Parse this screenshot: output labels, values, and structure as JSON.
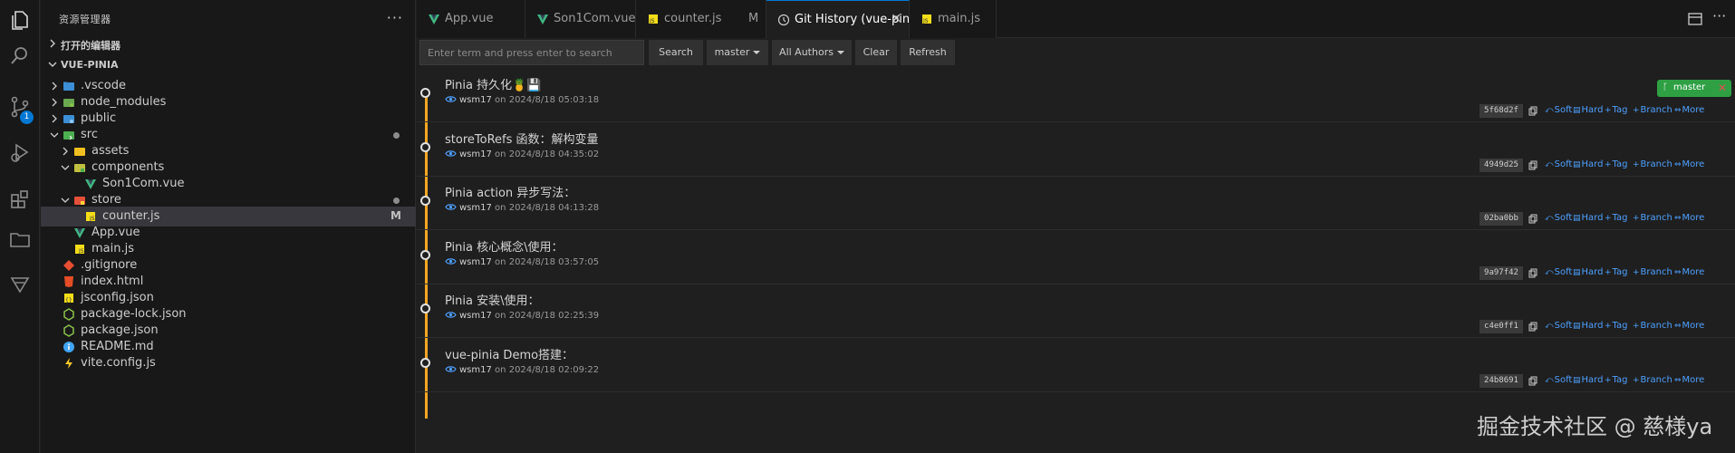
{
  "explorer": {
    "title": "资源管理器",
    "more": "···",
    "open_editors": "打开的编辑器",
    "project": "VUE-PINIA",
    "tree": [
      {
        "name": ".vscode",
        "indent": 1,
        "kind": "folder-vscode",
        "state": "collapsed"
      },
      {
        "name": "node_modules",
        "indent": 1,
        "kind": "folder-node",
        "state": "collapsed"
      },
      {
        "name": "public",
        "indent": 1,
        "kind": "folder-public",
        "state": "collapsed"
      },
      {
        "name": "src",
        "indent": 1,
        "kind": "folder-src",
        "state": "expanded",
        "dot": true
      },
      {
        "name": "assets",
        "indent": 2,
        "kind": "folder-assets",
        "state": "collapsed"
      },
      {
        "name": "components",
        "indent": 2,
        "kind": "folder-components",
        "state": "expanded"
      },
      {
        "name": "Son1Com.vue",
        "indent": 3,
        "kind": "vue"
      },
      {
        "name": "store",
        "indent": 2,
        "kind": "folder-store",
        "state": "expanded",
        "dot": true
      },
      {
        "name": "counter.js",
        "indent": 3,
        "kind": "js",
        "selected": true,
        "mod": "M"
      },
      {
        "name": "App.vue",
        "indent": 2,
        "kind": "vue"
      },
      {
        "name": "main.js",
        "indent": 2,
        "kind": "js"
      },
      {
        "name": ".gitignore",
        "indent": 1,
        "kind": "git"
      },
      {
        "name": "index.html",
        "indent": 1,
        "kind": "html"
      },
      {
        "name": "jsconfig.json",
        "indent": 1,
        "kind": "jsconfig"
      },
      {
        "name": "package-lock.json",
        "indent": 1,
        "kind": "node"
      },
      {
        "name": "package.json",
        "indent": 1,
        "kind": "node"
      },
      {
        "name": "README.md",
        "indent": 1,
        "kind": "info"
      },
      {
        "name": "vite.config.js",
        "indent": 1,
        "kind": "vite"
      }
    ]
  },
  "tabs": [
    {
      "label": "App.vue",
      "icon": "vue"
    },
    {
      "label": "Son1Com.vue",
      "icon": "vue"
    },
    {
      "label": "counter.js",
      "icon": "js",
      "mod": "M"
    },
    {
      "label": "Git History (vue-pinia)",
      "icon": "history",
      "active": true,
      "close": "✕"
    },
    {
      "label": "main.js",
      "icon": "js"
    }
  ],
  "toolbar": {
    "search_placeholder": "Enter term and press enter to search",
    "search": "Search",
    "branch": "master",
    "authors": "All Authors",
    "clear": "Clear",
    "refresh": "Refresh"
  },
  "branch_badge": {
    "label": "master",
    "close": "✕"
  },
  "actions": {
    "soft": "Soft",
    "hard": "Hard",
    "tag": "Tag",
    "branch": "Branch",
    "more": "More"
  },
  "commits": [
    {
      "message": "Pinia 持久化",
      "emoji": "🍍💾",
      "author": "wsm17",
      "on": "on",
      "date": "2024/8/18 05:03:18",
      "hash": "5f68d2f"
    },
    {
      "message": "storeToRefs 函数：解构变量",
      "author": "wsm17",
      "on": "on",
      "date": "2024/8/18 04:35:02",
      "hash": "4949d25"
    },
    {
      "message": "Pinia action 异步写法：",
      "author": "wsm17",
      "on": "on",
      "date": "2024/8/18 04:13:28",
      "hash": "02ba0bb"
    },
    {
      "message": "Pinia 核心概念\\使用：",
      "author": "wsm17",
      "on": "on",
      "date": "2024/8/18 03:57:05",
      "hash": "9a97f42"
    },
    {
      "message": "Pinia 安装\\使用：",
      "author": "wsm17",
      "on": "on",
      "date": "2024/8/18 02:25:39",
      "hash": "c4e0ff1"
    },
    {
      "message": "vue-pinia Demo搭建：",
      "author": "wsm17",
      "on": "on",
      "date": "2024/8/18 02:09:22",
      "hash": "24b8691"
    }
  ],
  "watermark": "掘金技术社区 @ 慈様ya",
  "colors": {
    "accent": "#0078d4",
    "graph": "#f5a623",
    "link": "#4ea0ff",
    "branch": "#2ea043"
  }
}
